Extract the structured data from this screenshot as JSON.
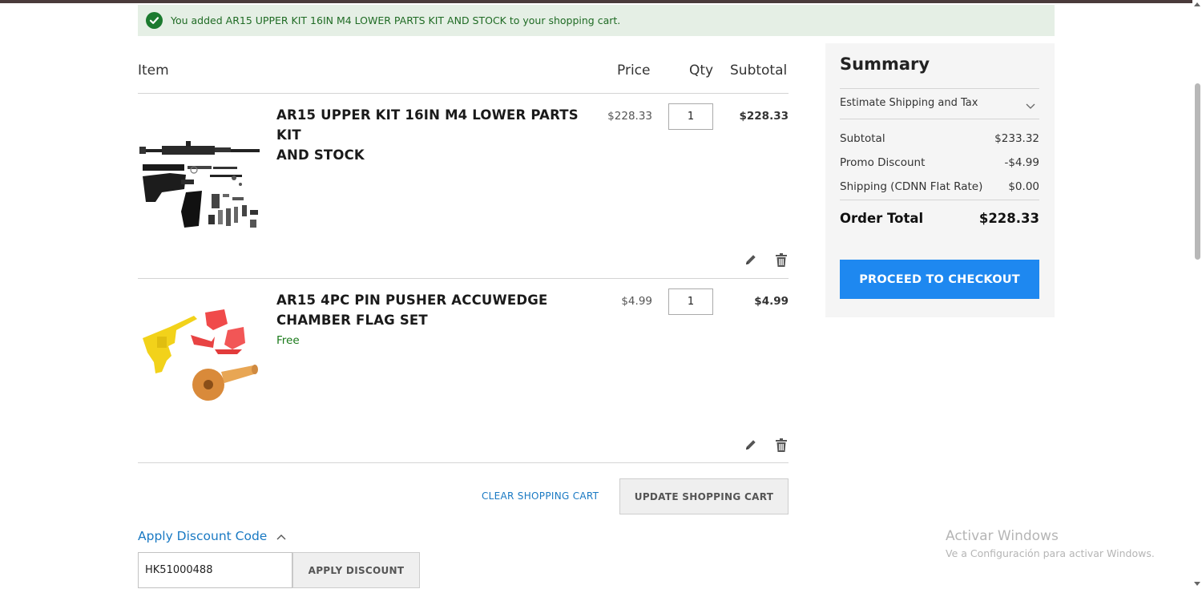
{
  "message": {
    "text": "You added AR15 UPPER KIT 16IN M4 LOWER PARTS KIT AND STOCK to your shopping cart.",
    "icon": "check-circle-icon"
  },
  "table": {
    "item": "Item",
    "price": "Price",
    "qty": "Qty",
    "subtotal": "Subtotal"
  },
  "items": [
    {
      "name_line1": "AR15 UPPER KIT 16IN M4 LOWER PARTS KIT",
      "name_line2": "AND STOCK",
      "price": "$228.33",
      "qty": "1",
      "subtotal": "$228.33"
    },
    {
      "name_line1": "AR15 4PC PIN PUSHER ACCUWEDGE",
      "name_line2": "CHAMBER FLAG SET",
      "price": "$4.99",
      "qty": "1",
      "subtotal": "$4.99",
      "note": "Free"
    }
  ],
  "cart_actions": {
    "clear": "CLEAR SHOPPING CART",
    "update": "UPDATE SHOPPING CART"
  },
  "discount": {
    "toggle": "Apply Discount Code",
    "code": "HK51000488",
    "apply": "APPLY DISCOUNT"
  },
  "summary": {
    "title": "Summary",
    "estimate": "Estimate Shipping and Tax",
    "subtotal_label": "Subtotal",
    "subtotal_value": "$233.32",
    "promo_label": "Promo Discount",
    "promo_value": "-$4.99",
    "shipping_label": "Shipping (CDNN Flat Rate)",
    "shipping_value": "$0.00",
    "total_label": "Order Total",
    "total_value": "$228.33",
    "checkout": "PROCEED TO CHECKOUT"
  },
  "watermark": {
    "line1": "Activar Windows",
    "line2": "Ve a Configuración para activar Windows."
  },
  "colors": {
    "accent": "#1e88f0",
    "link": "#1979c3",
    "success": "#1b7a2f",
    "summary_bg": "#f5f5f5"
  }
}
